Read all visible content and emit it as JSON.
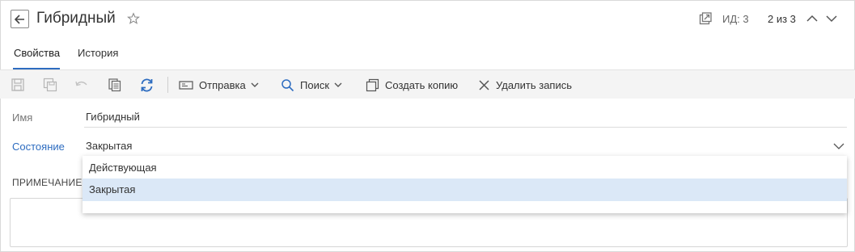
{
  "header": {
    "title": "Гибридный",
    "id_label": "ИД: 3",
    "pager_label": "2 из 3"
  },
  "tabs": [
    {
      "label": "Свойства",
      "active": true
    },
    {
      "label": "История",
      "active": false
    }
  ],
  "toolbar": {
    "send_label": "Отправка",
    "search_label": "Поиск",
    "copy_label": "Создать копию",
    "delete_label": "Удалить запись"
  },
  "form": {
    "name_label": "Имя",
    "name_value": "Гибридный",
    "state_label": "Состояние",
    "state_value": "Закрытая",
    "note_label": "ПРИМЕЧАНИЕ"
  },
  "dropdown": {
    "options": [
      {
        "label": "Действующая",
        "selected": false
      },
      {
        "label": "Закрытая",
        "selected": true
      }
    ]
  },
  "colors": {
    "accent": "#2d6cc0",
    "selected_bg": "#dbe8f7",
    "toolbar_bg": "#f4f4f4"
  }
}
